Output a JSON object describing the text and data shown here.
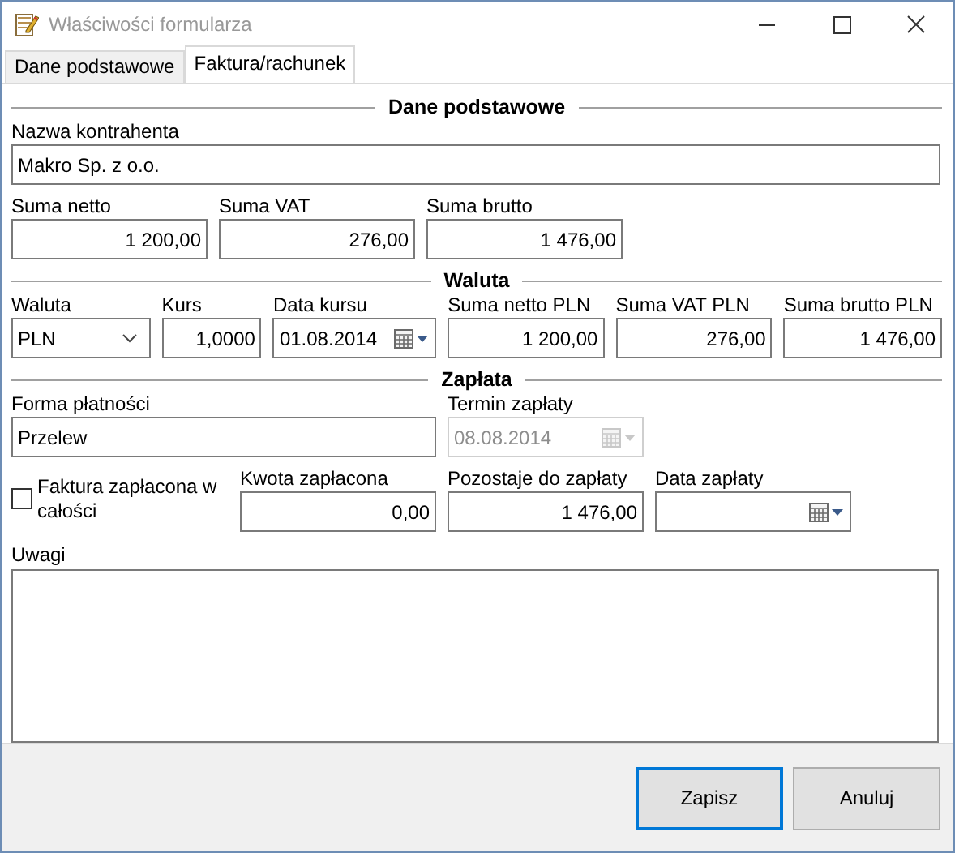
{
  "window": {
    "title": "Właściwości formularza"
  },
  "tabs": [
    {
      "label": "Dane podstawowe",
      "selected": false
    },
    {
      "label": "Faktura/rachunek",
      "selected": true
    }
  ],
  "sections": [
    {
      "heading": "Dane podstawowe",
      "groups": [
        {
          "fields": [
            {
              "kind": "text",
              "label": "Nazwa kontrahenta",
              "value": "Makro Sp. z o.o.",
              "disabled": false
            }
          ]
        },
        {
          "fields": [
            {
              "kind": "number",
              "label": "Suma netto",
              "value": "1 200,00",
              "disabled": false
            },
            {
              "kind": "number",
              "label": "Suma VAT",
              "value": "276,00",
              "disabled": false
            },
            {
              "kind": "number",
              "label": "Suma brutto",
              "value": "1 476,00",
              "disabled": false
            }
          ]
        }
      ]
    },
    {
      "heading": "Waluta",
      "groups": [
        {
          "fields": [
            {
              "kind": "combo",
              "label": "Waluta",
              "value": "PLN",
              "disabled": false
            },
            {
              "kind": "number",
              "label": "Kurs",
              "value": "1,0000",
              "disabled": false
            },
            {
              "kind": "date",
              "label": "Data kursu",
              "value": "01.08.2014",
              "disabled": false
            },
            {
              "kind": "number",
              "label": "Suma netto PLN",
              "value": "1 200,00",
              "disabled": false
            },
            {
              "kind": "number",
              "label": "Suma VAT PLN",
              "value": "276,00",
              "disabled": false
            },
            {
              "kind": "number",
              "label": "Suma brutto PLN",
              "value": "1 476,00",
              "disabled": false
            }
          ]
        }
      ]
    },
    {
      "heading": "Zapłata",
      "groups": [
        {
          "fields": [
            {
              "kind": "text",
              "label": "Forma płatności",
              "value": "Przelew",
              "disabled": false
            },
            {
              "kind": "date",
              "label": "Termin zapłaty",
              "value": "08.08.2014",
              "disabled": true
            }
          ]
        },
        {
          "fields": [
            {
              "kind": "checkbox",
              "label": "Faktura zapłacona w całości",
              "checked": false,
              "disabled": false
            },
            {
              "kind": "number",
              "label": "Kwota zapłacona",
              "value": "0,00",
              "disabled": false
            },
            {
              "kind": "number",
              "label": "Pozostaje do zapłaty",
              "value": "1 476,00",
              "disabled": false
            },
            {
              "kind": "date",
              "label": "Data zapłaty",
              "disabled": false
            }
          ]
        }
      ]
    }
  ],
  "notes": {
    "label": "Uwagi"
  },
  "buttons": [
    {
      "label": "Zapisz",
      "default": true
    },
    {
      "label": "Anuluj",
      "default": false
    }
  ]
}
